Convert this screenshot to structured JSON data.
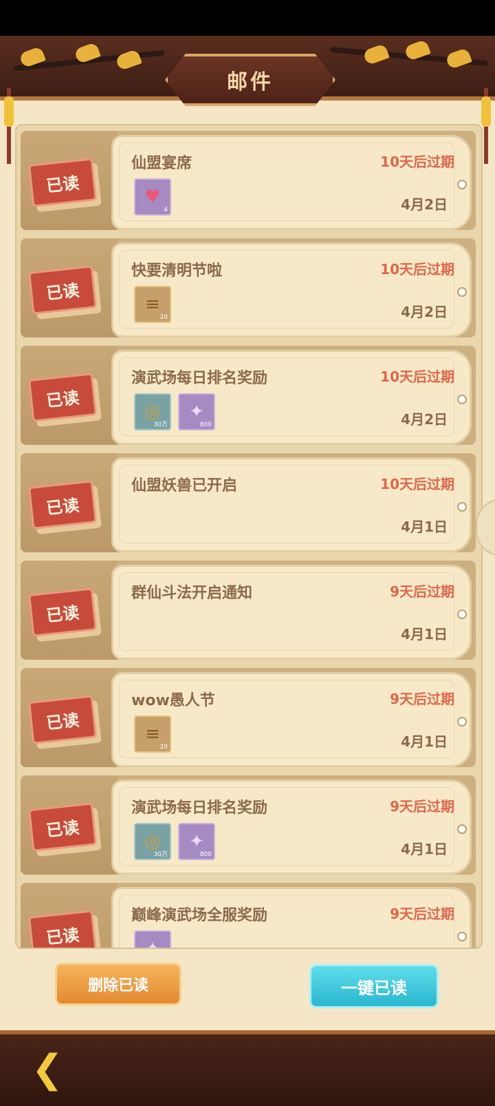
{
  "header": {
    "title": "邮件"
  },
  "mails": [
    {
      "title": "仙盟宴席",
      "expiry": "10天后过期",
      "date": "4月2日",
      "items": [
        {
          "type": "heart",
          "count": "4"
        }
      ]
    },
    {
      "title": "快要清明节啦",
      "expiry": "10天后过期",
      "date": "4月2日",
      "items": [
        {
          "type": "ticket",
          "count": "20"
        }
      ]
    },
    {
      "title": "演武场每日排名奖励",
      "expiry": "10天后过期",
      "date": "4月2日",
      "items": [
        {
          "type": "coin",
          "count": "30万"
        },
        {
          "type": "gem",
          "count": "800"
        }
      ]
    },
    {
      "title": "仙盟妖兽已开启",
      "expiry": "10天后过期",
      "date": "4月1日",
      "items": []
    },
    {
      "title": "群仙斗法开启通知",
      "expiry": "9天后过期",
      "date": "4月1日",
      "items": []
    },
    {
      "title": "wow愚人节",
      "expiry": "9天后过期",
      "date": "4月1日",
      "items": [
        {
          "type": "ticket",
          "count": "20"
        }
      ]
    },
    {
      "title": "演武场每日排名奖励",
      "expiry": "9天后过期",
      "date": "4月1日",
      "items": [
        {
          "type": "coin",
          "count": "30万"
        },
        {
          "type": "gem",
          "count": "800"
        }
      ]
    },
    {
      "title": "巅峰演武场全服奖励",
      "expiry": "9天后过期",
      "date": "",
      "items": [
        {
          "type": "gem",
          "count": ""
        }
      ]
    }
  ],
  "read_label": "已读",
  "buttons": {
    "delete_read": "删除已读",
    "read_all": "一键已读"
  }
}
